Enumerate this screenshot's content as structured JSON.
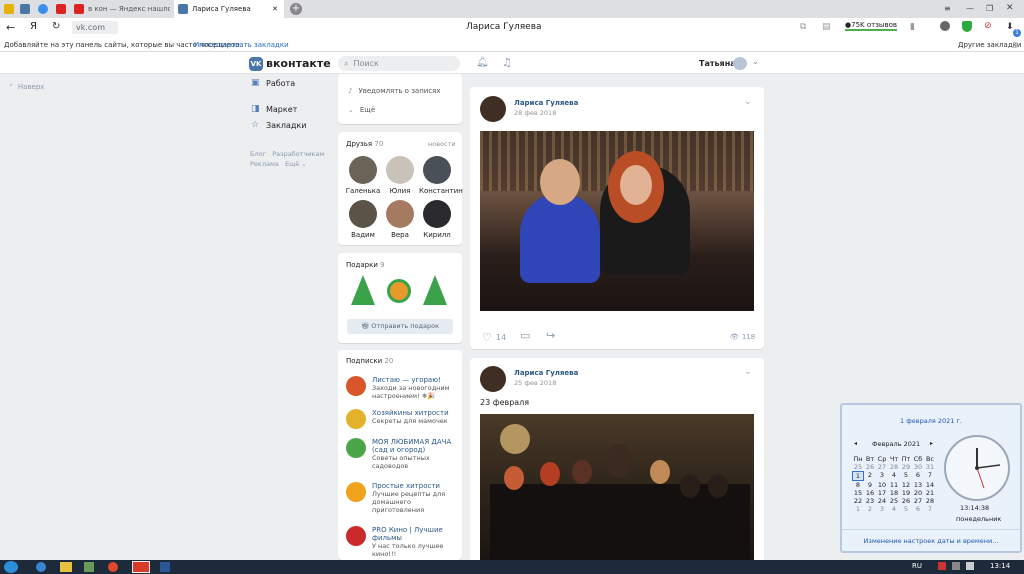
{
  "browser": {
    "tabs": [
      {
        "label": "",
        "color": "#e8b000"
      },
      {
        "label": "",
        "color": "#4a76a8"
      },
      {
        "label": "",
        "color": "#3a8fe8"
      },
      {
        "label": "",
        "color": "#d22"
      },
      {
        "label": "в кон — Яндекс нашлос",
        "color": "#d22"
      },
      {
        "label": "Лариса Гуляева",
        "color": "#4a76a8"
      }
    ],
    "page_title": "Лариса Гуляева",
    "url": "vk.com",
    "yandex_letter": "Я",
    "reviews_badge": "75K отзывов",
    "bookmarks_hint": "Добавляйте на эту панель сайты, которые вы часто посещаете.",
    "import_bookmarks": "Импортировать закладки",
    "other_bookmarks": "Другие закладки",
    "download_count": "1"
  },
  "vk": {
    "logo": "вконтакте",
    "search_placeholder": "Поиск",
    "user_name": "Татьяна",
    "back_up": "Наверх",
    "left_menu": [
      "Работа",
      "Маркет",
      "Закладки"
    ],
    "footer_links": [
      "Блог",
      "Разработчикам",
      "Реклама",
      "Ещё ⌄"
    ],
    "profile_actions": [
      "Уведомлять о записях",
      "Ещё"
    ],
    "friends": {
      "title": "Друзья",
      "count": "70",
      "news": "новости",
      "items": [
        "Галенька",
        "Юлия",
        "Константин",
        "Вадим",
        "Вера",
        "Кирилл"
      ]
    },
    "gifts": {
      "title": "Подарки",
      "count": "9",
      "send": "Отправить подарок"
    },
    "subscriptions": {
      "title": "Подписки",
      "count": "20",
      "items": [
        {
          "name": "Листаю — угораю!",
          "desc": "Заходи за новогодним настроением! ❄🎉"
        },
        {
          "name": "Хозяйкины хитрости",
          "desc": "Секреты для мамочек"
        },
        {
          "name": "МОЯ ЛЮБИМАЯ ДАЧА (сад и огород)",
          "desc": "Советы опытных садоводов"
        },
        {
          "name": "Простые хитрости",
          "desc": "Лучшие рецепты для домашнего приготовления"
        },
        {
          "name": "PRO Кино | Лучшие фильмы",
          "desc": "У нас только лучшее кино!!!"
        }
      ]
    },
    "posts": [
      {
        "author": "Лариса Гуляева",
        "date": "28 фев 2018",
        "text": "",
        "likes": "14",
        "views": "118"
      },
      {
        "author": "Лариса Гуляева",
        "date": "25 фев 2018",
        "text": "23 февраля"
      }
    ]
  },
  "calendar": {
    "date_link": "1 февраля 2021 г.",
    "month": "Февраль 2021",
    "weekdays": [
      "Пн",
      "Вт",
      "Ср",
      "Чт",
      "Пт",
      "Сб",
      "Вс"
    ],
    "weeks": [
      [
        "25",
        "26",
        "27",
        "28",
        "29",
        "30",
        "31"
      ],
      [
        "1",
        "2",
        "3",
        "4",
        "5",
        "6",
        "7"
      ],
      [
        "8",
        "9",
        "10",
        "11",
        "12",
        "13",
        "14"
      ],
      [
        "15",
        "16",
        "17",
        "18",
        "19",
        "20",
        "21"
      ],
      [
        "22",
        "23",
        "24",
        "25",
        "26",
        "27",
        "28"
      ],
      [
        "1",
        "2",
        "3",
        "4",
        "5",
        "6",
        "7"
      ]
    ],
    "time": "13:14:38",
    "weekday": "понедельник",
    "settings_link": "Изменение настроек даты и времени..."
  },
  "taskbar": {
    "lang": "RU",
    "clock": "13:14"
  }
}
